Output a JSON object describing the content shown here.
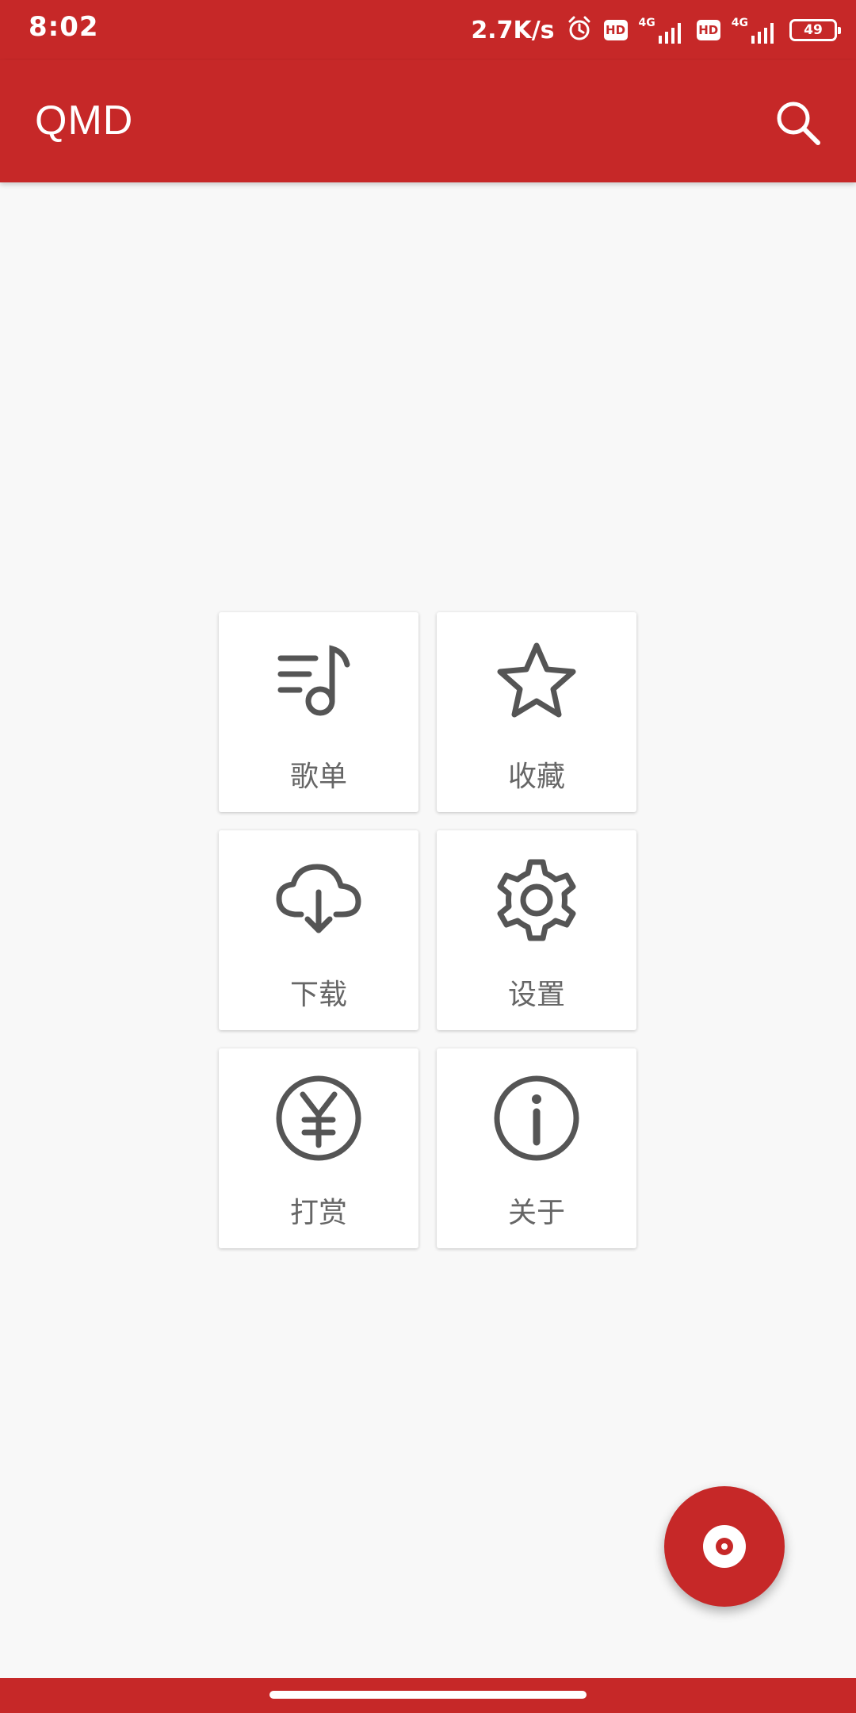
{
  "status_bar": {
    "time": "8:02",
    "net_speed": "2.7K/s",
    "hd_1": "HD",
    "hd_2": "HD",
    "net_type_1": "4G",
    "net_type_2": "4G",
    "battery": "49",
    "icons": [
      "alarm-icon",
      "signal-icon",
      "battery-icon"
    ]
  },
  "toolbar": {
    "title": "QMD",
    "search_icon": "search-icon"
  },
  "menu": {
    "items": [
      {
        "label": "歌单",
        "icon": "playlist-icon"
      },
      {
        "label": "收藏",
        "icon": "star-icon"
      },
      {
        "label": "下载",
        "icon": "cloud-download-icon"
      },
      {
        "label": "设置",
        "icon": "gear-icon"
      },
      {
        "label": "打赏",
        "icon": "yuan-icon"
      },
      {
        "label": "关于",
        "icon": "info-icon"
      }
    ]
  },
  "fab": {
    "icon": "disc-icon"
  },
  "colors": {
    "primary": "#c62828",
    "background": "#f8f8f8",
    "tile": "#ffffff",
    "icon": "#555555",
    "label": "#666666"
  }
}
